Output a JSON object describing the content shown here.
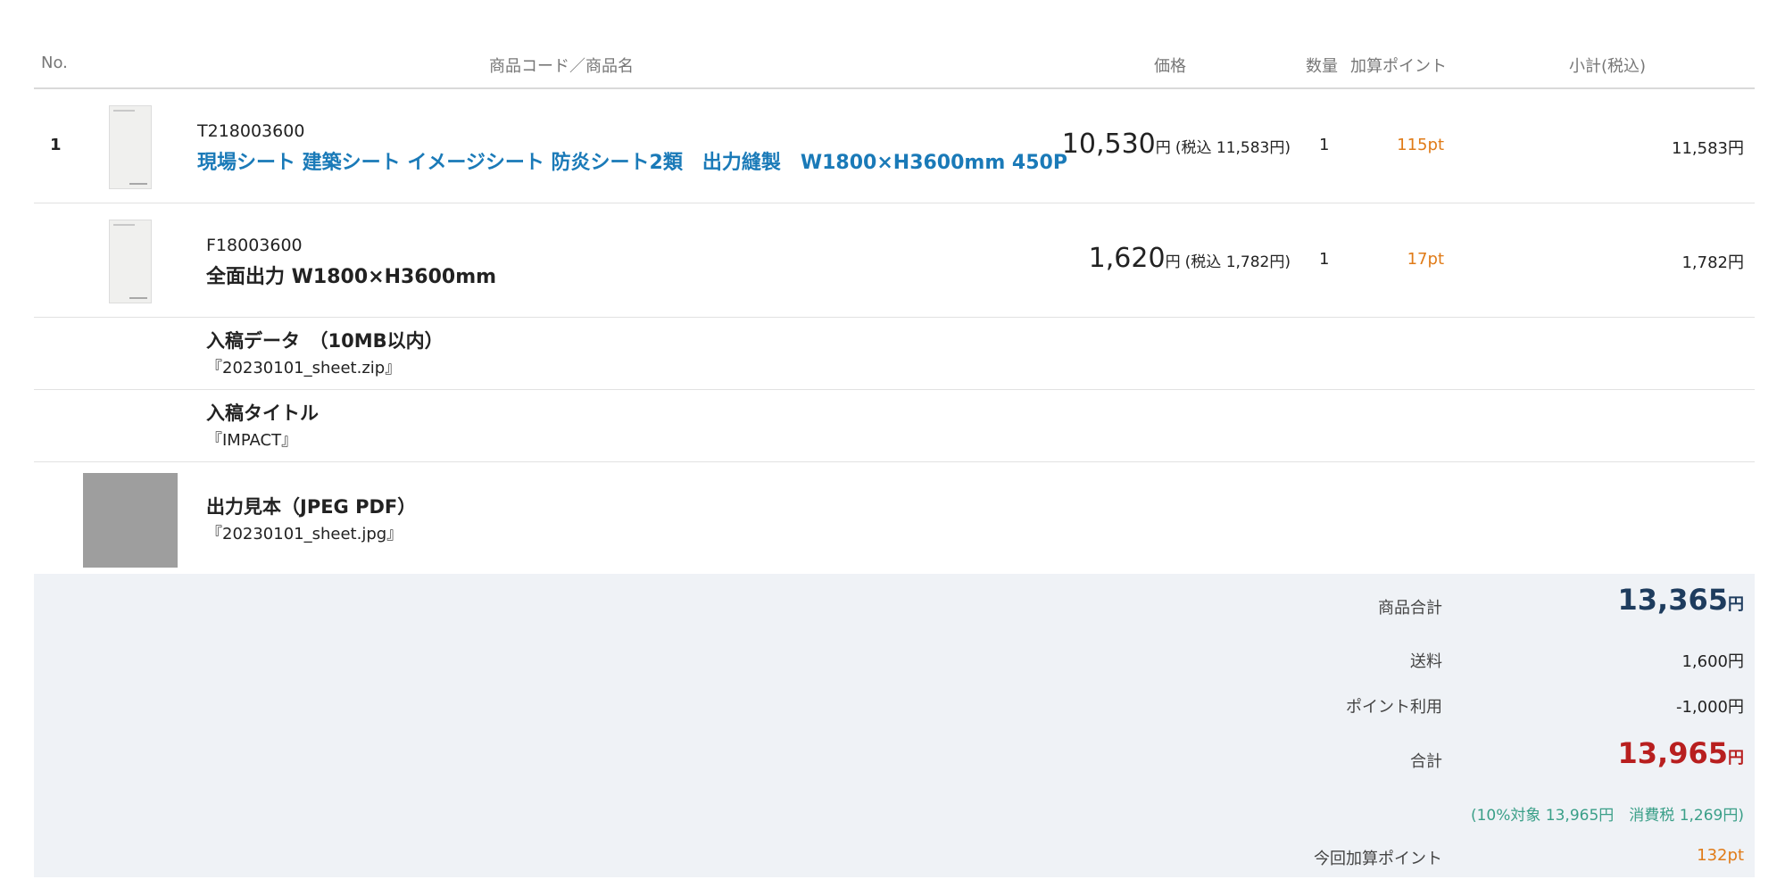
{
  "header": {
    "no": "No.",
    "name": "商品コード／商品名",
    "price": "価格",
    "qty": "数量",
    "points": "加算ポイント",
    "subtotal": "小計(税込)"
  },
  "items": [
    {
      "no": "1",
      "code": "T218003600",
      "name": "現場シート 建築シート イメージシート 防炎シート2類　出力縫製　W1800×H3600mm 450P",
      "price": "10,530",
      "price_unit": "円",
      "price_tax": "(税込 11,583円)",
      "qty": "1",
      "points": "115pt",
      "subtotal": "11,583円"
    },
    {
      "no": "",
      "code": "F18003600",
      "name": "全面出力 W1800×H3600mm",
      "price": "1,620",
      "price_unit": "円",
      "price_tax": "(税込 1,782円)",
      "qty": "1",
      "points": "17pt",
      "subtotal": "1,782円"
    }
  ],
  "upload_data": {
    "title": "入稿データ　（10MB以内）",
    "value": "『20230101_sheet.zip』"
  },
  "upload_title": {
    "title": "入稿タイトル",
    "value": "『IMPACT』"
  },
  "sample": {
    "title": "出力見本（JPEG PDF）",
    "value": "『20230101_sheet.jpg』"
  },
  "summary": {
    "goods_total_label": "商品合計",
    "goods_total_value": "13,365",
    "goods_total_unit": "円",
    "shipping_label": "送料",
    "shipping_value": "1,600円",
    "points_used_label": "ポイント利用",
    "points_used_value": "-1,000円",
    "total_label": "合計",
    "total_value": "13,965",
    "total_unit": "円",
    "tax_note": "(10%対象 13,965円　消費税 1,269円)",
    "earned_points_label": "今回加算ポイント",
    "earned_points_value": "132pt"
  },
  "colors": {
    "link": "#1a7ab8",
    "points": "#e07b18",
    "total_navy": "#1e3c5e",
    "total_red": "#b81f1f",
    "tax_note": "#3a9f88",
    "summary_bg": "#eff2f6"
  }
}
